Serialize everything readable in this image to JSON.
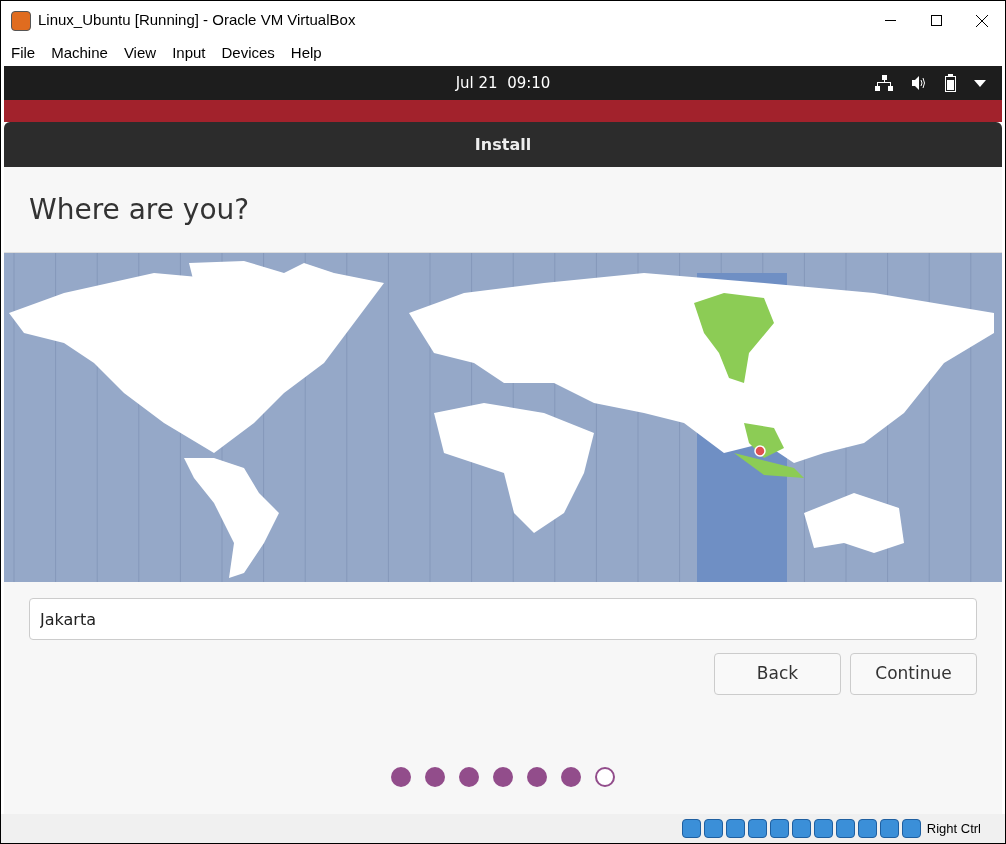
{
  "window": {
    "title": "Linux_Ubuntu [Running] - Oracle VM VirtualBox"
  },
  "menu": [
    "File",
    "Machine",
    "View",
    "Input",
    "Devices",
    "Help"
  ],
  "top_panel": {
    "clock": "Jul 21  09:10"
  },
  "installer": {
    "title": "Install",
    "heading": "Where are you?",
    "location_field": {
      "value": "Jakarta"
    },
    "buttons": [
      "Back",
      "Continue"
    ],
    "steps": [
      {
        "done": true
      },
      {
        "done": true
      },
      {
        "done": true
      },
      {
        "done": true
      },
      {
        "done": true
      },
      {
        "done": true
      },
      {
        "done": false
      }
    ]
  },
  "status_bar": {
    "host_key": "Right Ctrl"
  }
}
